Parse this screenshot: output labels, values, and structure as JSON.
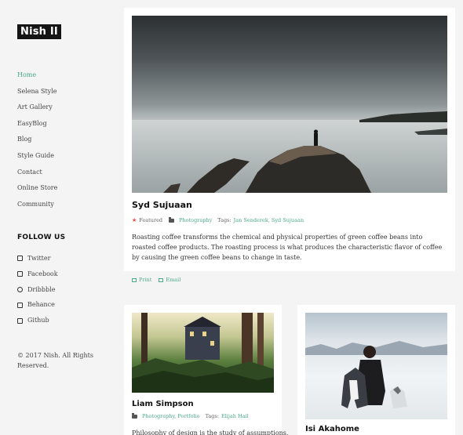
{
  "site": {
    "logo": "Nish II"
  },
  "nav": {
    "items": [
      "Home",
      "Selena Style",
      "Art Gallery",
      "EasyBlog",
      "Blog",
      "Style Guide",
      "Contact",
      "Online Store",
      "Community"
    ]
  },
  "follow": {
    "title": "FOLLOW US",
    "items": [
      {
        "label": "Twitter",
        "icon": "twitter-icon"
      },
      {
        "label": "Facebook",
        "icon": "facebook-icon"
      },
      {
        "label": "Dribbble",
        "icon": "dribbble-icon"
      },
      {
        "label": "Behance",
        "icon": "behance-icon"
      },
      {
        "label": "Github",
        "icon": "github-icon"
      }
    ]
  },
  "footer": {
    "copyright": "© 2017 Nish. All Rights Reserved."
  },
  "posts": [
    {
      "title": "Syd Sujuaan",
      "featured": "Featured",
      "category": "Photography",
      "tags_label": "Tags:",
      "tags": "Jan Senderek, Syd Sujuaan",
      "excerpt": "Roasting coffee transforms the chemical and physical properties of green coffee beans into roasted coffee products. The roasting process is what produces the characteristic flavor of coffee by causing the green coffee beans to change in taste.",
      "print": "Print",
      "email": "Email"
    },
    {
      "title": "Liam Simpson",
      "category": "Photography, Portfolio",
      "tags_label": "Tags:",
      "tags": "Elijah Hail",
      "excerpt": "Philosophy of design is the study of assumptions,"
    },
    {
      "title": "Isi Akahome"
    }
  ],
  "colors": {
    "accent": "#4aa989",
    "logo_bg": "#151515",
    "page_bg": "#f4f4f4",
    "featured_star": "#d9534f"
  }
}
